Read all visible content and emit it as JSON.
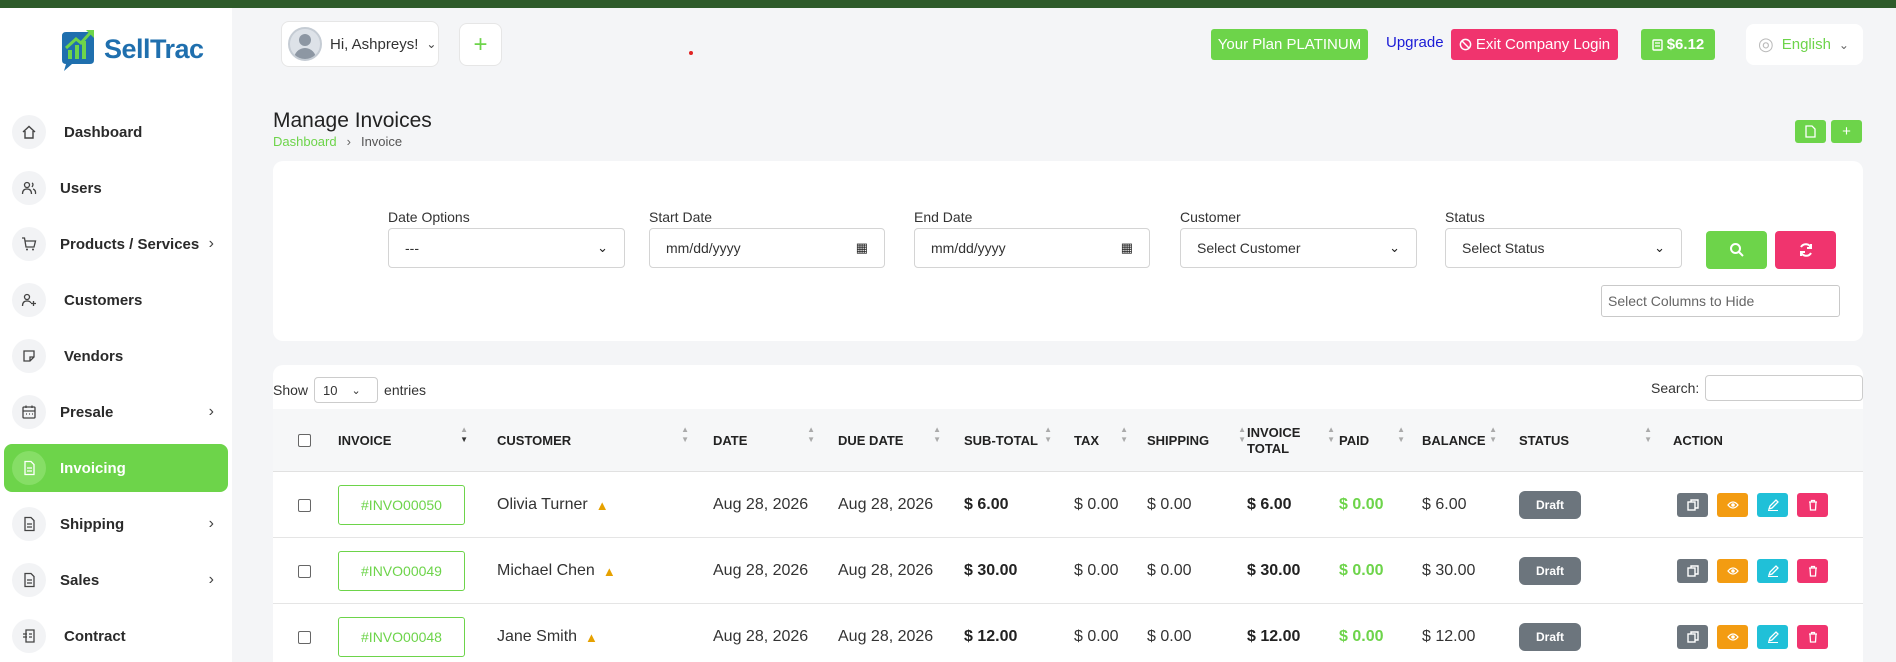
{
  "brand": {
    "name": "SellTrac"
  },
  "sidebar": {
    "items": [
      {
        "label": "Dashboard",
        "icon": "home-icon",
        "has_submenu": false,
        "active": false
      },
      {
        "label": "Users",
        "icon": "users-icon",
        "has_submenu": false,
        "active": false
      },
      {
        "label": "Products / Services",
        "icon": "cart-icon",
        "has_submenu": true,
        "active": false
      },
      {
        "label": "Customers",
        "icon": "user-plus-icon",
        "has_submenu": false,
        "active": false
      },
      {
        "label": "Vendors",
        "icon": "sticky-note-icon",
        "has_submenu": false,
        "active": false
      },
      {
        "label": "Presale",
        "icon": "calendar-icon",
        "has_submenu": true,
        "active": false
      },
      {
        "label": "Invoicing",
        "icon": "file-icon",
        "has_submenu": false,
        "active": true
      },
      {
        "label": "Shipping",
        "icon": "file-icon",
        "has_submenu": true,
        "active": false
      },
      {
        "label": "Sales",
        "icon": "file-icon",
        "has_submenu": true,
        "active": false
      },
      {
        "label": "Contract",
        "icon": "contract-icon",
        "has_submenu": false,
        "active": false
      }
    ]
  },
  "topbar": {
    "greeting": "Hi, Ashpreys!",
    "plus": "+",
    "plan": "Your Plan PLATINUM",
    "upgrade": "Upgrade",
    "exit": "Exit Company Login",
    "balance": "$6.12",
    "language": "English"
  },
  "page": {
    "title": "Manage Invoices",
    "breadcrumb": {
      "home": "Dashboard",
      "separator": "›",
      "current": "Invoice"
    }
  },
  "filters": {
    "date_options": {
      "label": "Date Options",
      "value": "---"
    },
    "start_date": {
      "label": "Start Date",
      "placeholder": "mm/dd/yyyy"
    },
    "end_date": {
      "label": "End Date",
      "placeholder": "mm/dd/yyyy"
    },
    "customer": {
      "label": "Customer",
      "value": "Select Customer"
    },
    "status": {
      "label": "Status",
      "value": "Select Status"
    },
    "hide_columns_placeholder": "Select Columns to Hide"
  },
  "table_controls": {
    "show": "Show",
    "entries_value": "10",
    "entries": "entries",
    "search_label": "Search:"
  },
  "table": {
    "columns": [
      "INVOICE",
      "CUSTOMER",
      "DATE",
      "DUE DATE",
      "SUB-TOTAL",
      "TAX",
      "SHIPPING",
      "INVOICE TOTAL",
      "PAID",
      "BALANCE",
      "STATUS",
      "ACTION"
    ],
    "rows": [
      {
        "invoice": "#INVO00050",
        "customer": "Olivia Turner",
        "date": "Aug 28, 2026",
        "due_date": "Aug 28, 2026",
        "subtotal": "$ 6.00",
        "tax": "$ 0.00",
        "shipping": "$ 0.00",
        "total": "$ 6.00",
        "paid": "$ 0.00",
        "balance": "$ 6.00",
        "status": "Draft"
      },
      {
        "invoice": "#INVO00049",
        "customer": "Michael Chen",
        "date": "Aug 28, 2026",
        "due_date": "Aug 28, 2026",
        "subtotal": "$ 30.00",
        "tax": "$ 0.00",
        "shipping": "$ 0.00",
        "total": "$ 30.00",
        "paid": "$ 0.00",
        "balance": "$ 30.00",
        "status": "Draft"
      },
      {
        "invoice": "#INVO00048",
        "customer": "Jane Smith",
        "date": "Aug 28, 2026",
        "due_date": "Aug 28, 2026",
        "subtotal": "$ 12.00",
        "tax": "$ 0.00",
        "shipping": "$ 0.00",
        "total": "$ 12.00",
        "paid": "$ 0.00",
        "balance": "$ 12.00",
        "status": "Draft"
      }
    ]
  },
  "colors": {
    "accent": "#6dd44a",
    "danger": "#f0346e",
    "warning": "#f39c12",
    "info": "#20c0d8",
    "muted": "#6c757d"
  }
}
